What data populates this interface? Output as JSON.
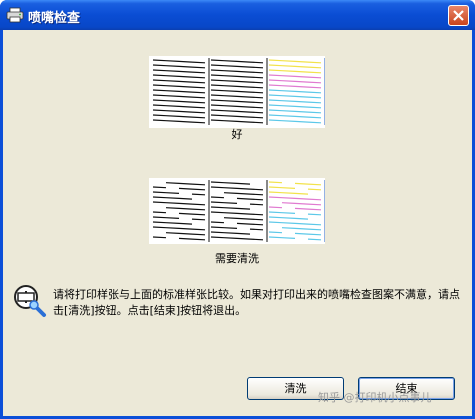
{
  "window": {
    "title": "喷嘴检查",
    "title_icon": "printer-icon",
    "close_icon": "close-icon"
  },
  "patterns": {
    "good_caption": "好",
    "clean_caption": "需要清洗"
  },
  "message": {
    "icon": "printer-magnifier-icon",
    "text": "请将打印样张与上面的标准样张比较。如果对打印出来的喷嘴检查图案不满意，请点击[清洗]按钮。点击[结束]按钮将退出。"
  },
  "buttons": {
    "clean_label": "清洗",
    "finish_label": "结束"
  },
  "watermark": "知乎 @打印机小点事儿",
  "colors": {
    "titlebar": "#0a4dd4",
    "client_bg": "#ece9d8",
    "yellow": "#f2e24a",
    "magenta": "#e07ad0",
    "cyan": "#5cc8e8"
  }
}
